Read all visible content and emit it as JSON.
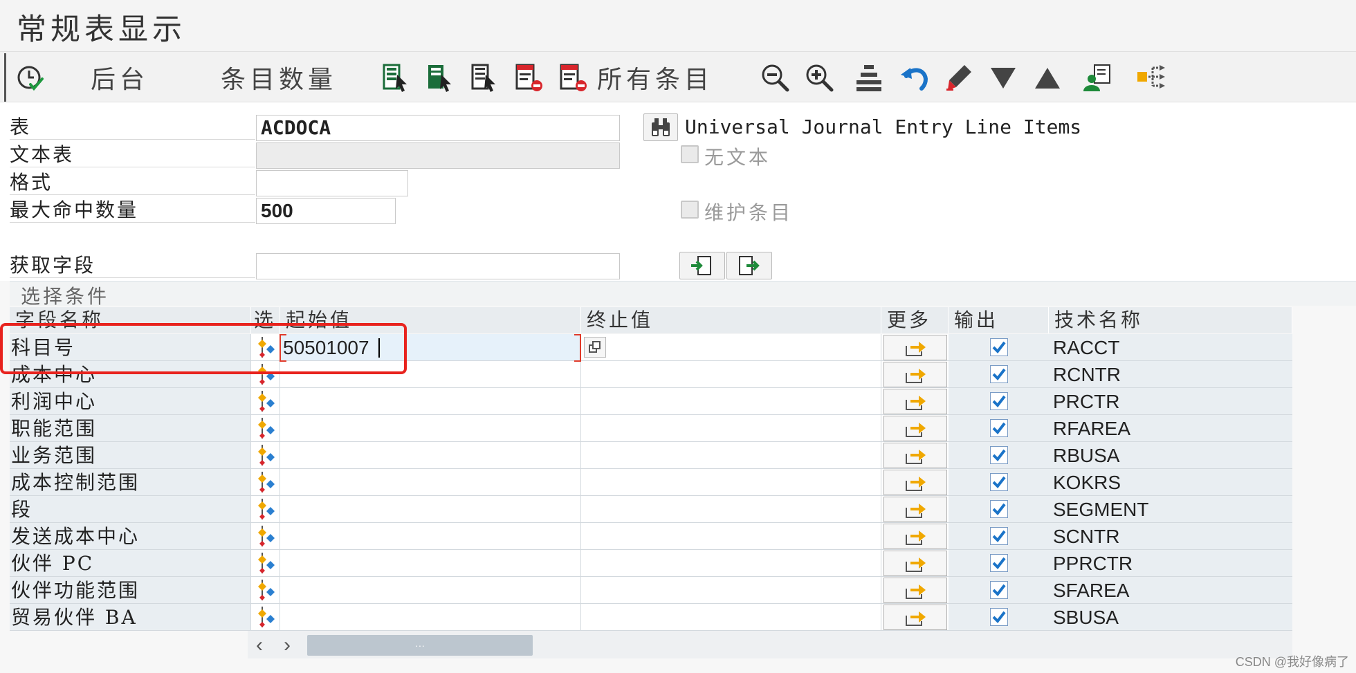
{
  "window": {
    "title": "常规表显示"
  },
  "toolbar": {
    "back_label": "后台",
    "count_label": "条目数量",
    "all_entries_label": "所有条目"
  },
  "form": {
    "table_label": "表",
    "table_value": "ACDOCA",
    "table_description": "Universal Journal Entry Line Items",
    "text_table_label": "文本表",
    "text_table_value": "",
    "no_text_label": "无文本",
    "format_label": "格式",
    "format_value": "",
    "max_hits_label": "最大命中数量",
    "max_hits_value": "500",
    "maintain_entries_label": "维护条目",
    "fetch_fields_label": "获取字段",
    "fetch_fields_value": ""
  },
  "selection": {
    "section_title": "选择条件",
    "columns": {
      "field_name": "字段名称",
      "select": "选",
      "from": "起始值",
      "to": "终止值",
      "more": "更多",
      "output": "输出",
      "tech_name": "技术名称"
    },
    "rows": [
      {
        "name": "科目号",
        "from": "50501007",
        "to": "",
        "output": true,
        "tech": "RACCT"
      },
      {
        "name": "成本中心",
        "from": "",
        "to": "",
        "output": true,
        "tech": "RCNTR"
      },
      {
        "name": "利润中心",
        "from": "",
        "to": "",
        "output": true,
        "tech": "PRCTR"
      },
      {
        "name": "职能范围",
        "from": "",
        "to": "",
        "output": true,
        "tech": "RFAREA"
      },
      {
        "name": "业务范围",
        "from": "",
        "to": "",
        "output": true,
        "tech": "RBUSA"
      },
      {
        "name": "成本控制范围",
        "from": "",
        "to": "",
        "output": true,
        "tech": "KOKRS"
      },
      {
        "name": "段",
        "from": "",
        "to": "",
        "output": true,
        "tech": "SEGMENT"
      },
      {
        "name": "发送成本中心",
        "from": "",
        "to": "",
        "output": true,
        "tech": "SCNTR"
      },
      {
        "name": "伙伴 PC",
        "from": "",
        "to": "",
        "output": true,
        "tech": "PPRCTR"
      },
      {
        "name": "伙伴功能范围",
        "from": "",
        "to": "",
        "output": true,
        "tech": "SFAREA"
      },
      {
        "name": "贸易伙伴 BA",
        "from": "",
        "to": "",
        "output": true,
        "tech": "SBUSA"
      }
    ]
  },
  "scrollbar": {
    "thumb_label": "···"
  },
  "watermark": "CSDN @我好像病了",
  "colors": {
    "highlight": "#e8231e",
    "accent_blue": "#1a73c8",
    "sap_green": "#1e8a3a"
  },
  "icons": [
    "execute-icon",
    "select-all-icon",
    "zoom-out-icon",
    "zoom-in-icon",
    "undo-icon",
    "delete-entry-icon",
    "sort-desc-icon",
    "sort-asc-icon",
    "user-settings-icon",
    "split-icon",
    "binoculars-icon",
    "multiple-selection-icon",
    "more-arrow-icon"
  ]
}
